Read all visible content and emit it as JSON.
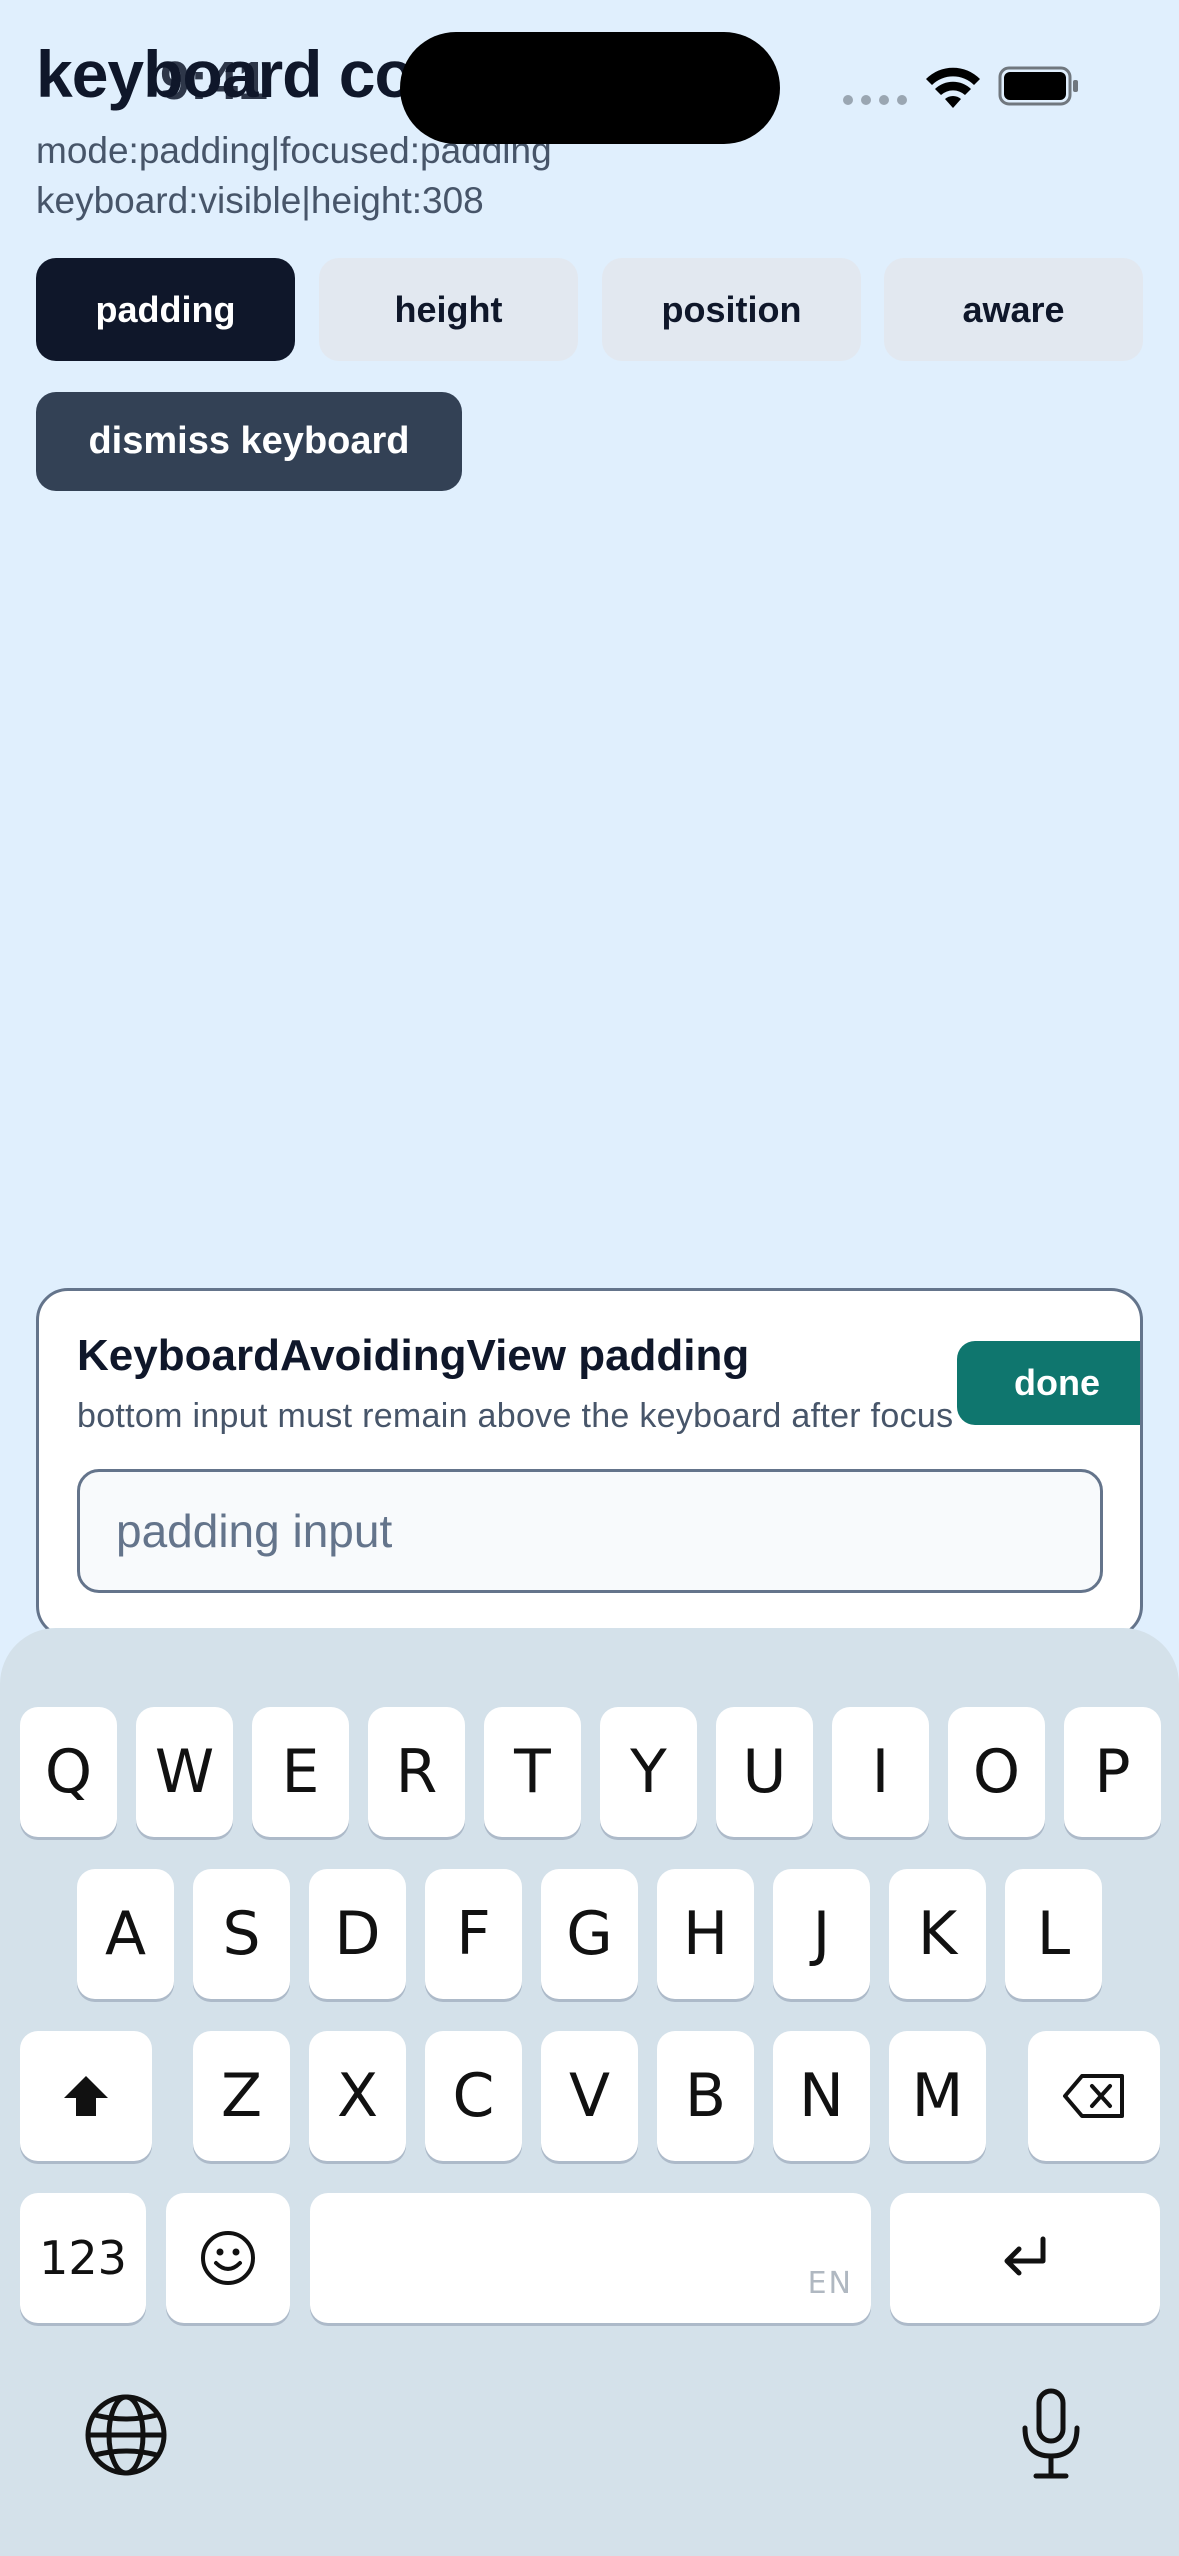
{
  "app": {
    "title": "keyboard co",
    "status_mode": "mode:padding|focused:padding",
    "status_keyboard": "keyboard:visible|height:308"
  },
  "status_bar": {
    "time": "9:41"
  },
  "mode_buttons": [
    {
      "label": "padding",
      "active": true
    },
    {
      "label": "height",
      "active": false
    },
    {
      "label": "position",
      "active": false
    },
    {
      "label": "aware",
      "active": false
    }
  ],
  "dismiss_label": "dismiss keyboard",
  "card": {
    "title": "KeyboardAvoidingView padding",
    "subtitle": "bottom input must remain above the keyboard after focus",
    "done_label": "done",
    "input_placeholder": "padding input",
    "input_value": ""
  },
  "keyboard": {
    "row1": [
      "Q",
      "W",
      "E",
      "R",
      "T",
      "Y",
      "U",
      "I",
      "O",
      "P"
    ],
    "row2": [
      "A",
      "S",
      "D",
      "F",
      "G",
      "H",
      "J",
      "K",
      "L"
    ],
    "row3": [
      "Z",
      "X",
      "C",
      "V",
      "B",
      "N",
      "M"
    ],
    "numbers_label": "123",
    "space_locale": "EN"
  },
  "colors": {
    "background": "#e0effd",
    "primary_dark": "#0f172a",
    "done_green": "#0f766e",
    "keyboard_bg": "#d4e1ea"
  },
  "icons": [
    "wifi-icon",
    "battery-icon",
    "shift-icon",
    "backspace-icon",
    "emoji-icon",
    "return-icon",
    "globe-icon",
    "microphone-icon"
  ]
}
